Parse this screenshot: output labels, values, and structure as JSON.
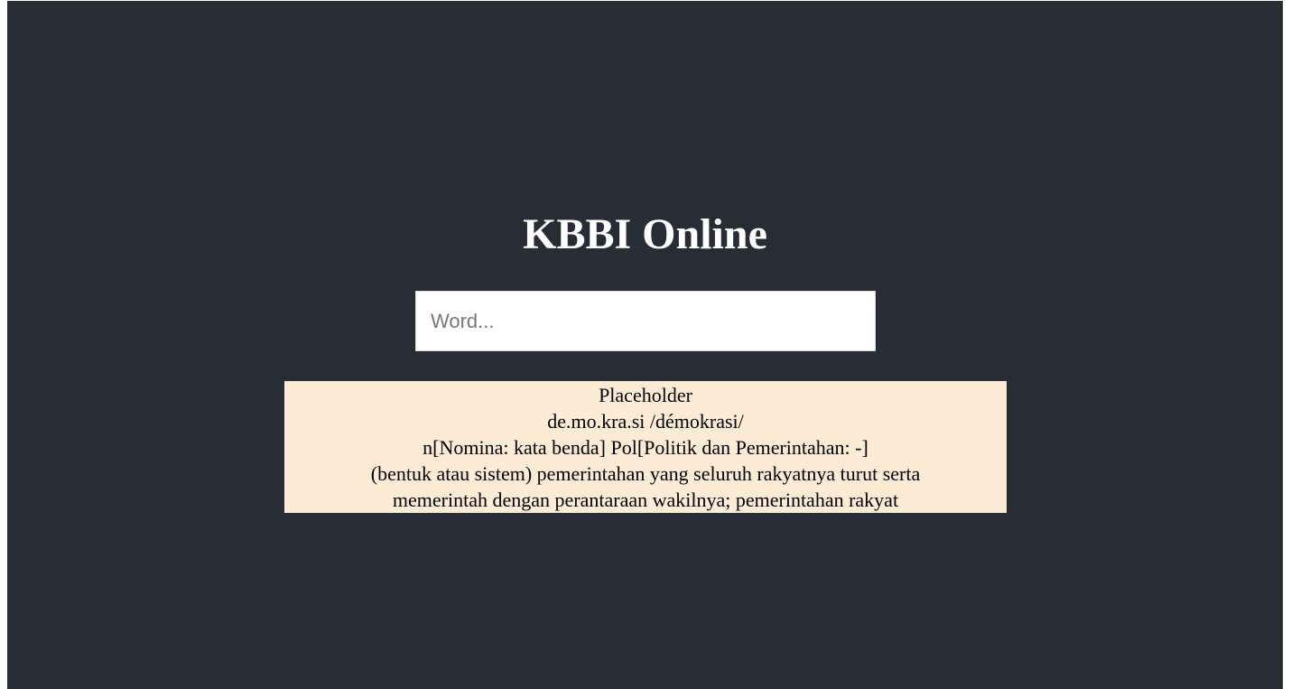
{
  "app": {
    "title": "KBBI Online"
  },
  "search": {
    "placeholder": "Word...",
    "value": ""
  },
  "result": {
    "heading": "Placeholder",
    "pronunciation": "de.mo.kra.si /démokrasi/",
    "word_class": "n[Nomina: kata benda] Pol[Politik dan Pemerintahan: -]",
    "definition_line1": "(bentuk atau sistem) pemerintahan yang seluruh rakyatnya turut serta",
    "definition_line2": "memerintah dengan perantaraan wakilnya; pemerintahan rakyat"
  },
  "colors": {
    "background": "#282c34",
    "result_background": "#fcebd5",
    "title_text": "#ffffff"
  }
}
